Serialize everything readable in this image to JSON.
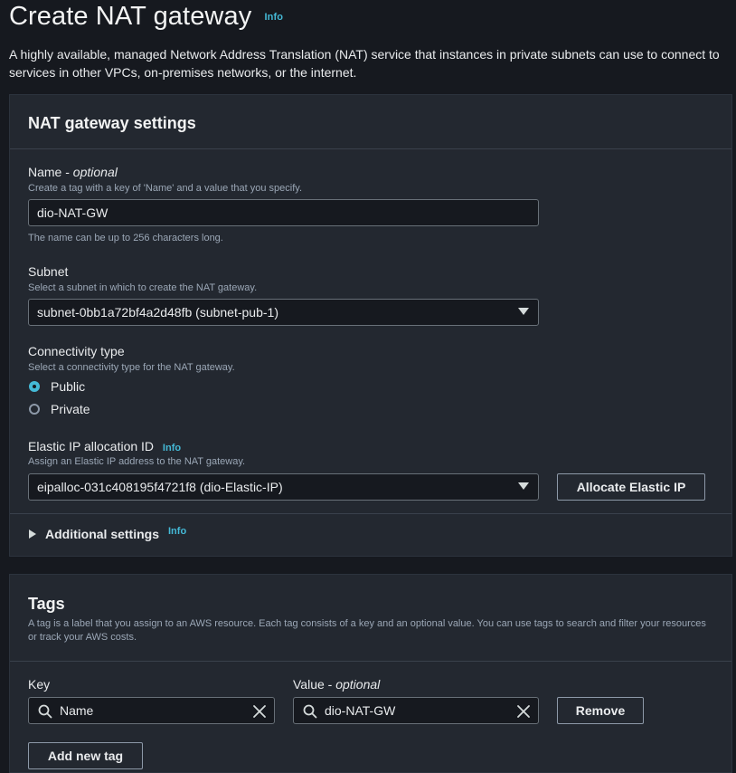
{
  "header": {
    "title": "Create NAT gateway",
    "info": "Info",
    "description": "A highly available, managed Network Address Translation (NAT) service that instances in private subnets can use to connect to services in other VPCs, on-premises networks, or the internet."
  },
  "settings": {
    "title": "NAT gateway settings",
    "name": {
      "label": "Name - ",
      "label_suffix": "optional",
      "description": "Create a tag with a key of 'Name' and a value that you specify.",
      "value": "dio-NAT-GW",
      "constraint": "The name can be up to 256 characters long."
    },
    "subnet": {
      "label": "Subnet",
      "description": "Select a subnet in which to create the NAT gateway.",
      "value": "subnet-0bb1a72bf4a2d48fb (subnet-pub-1)"
    },
    "connectivity": {
      "label": "Connectivity type",
      "description": "Select a connectivity type for the NAT gateway.",
      "options": [
        {
          "label": "Public",
          "selected": true
        },
        {
          "label": "Private",
          "selected": false
        }
      ]
    },
    "elastic_ip": {
      "label": "Elastic IP allocation ID",
      "info": "Info",
      "description": "Assign an Elastic IP address to the NAT gateway.",
      "value": "eipalloc-031c408195f4721f8 (dio-Elastic-IP)",
      "allocate_button": "Allocate Elastic IP"
    },
    "additional": {
      "label": "Additional settings",
      "info": "Info"
    }
  },
  "tags": {
    "title": "Tags",
    "description": "A tag is a label that you assign to an AWS resource. Each tag consists of a key and an optional value. You can use tags to search and filter your resources or track your AWS costs.",
    "key_label": "Key",
    "value_label": "Value - ",
    "value_label_suffix": "optional",
    "rows": [
      {
        "key": "Name",
        "value": "dio-NAT-GW",
        "remove": "Remove"
      }
    ],
    "add_button": "Add new tag"
  },
  "colors": {
    "background": "#16191f",
    "panel": "#232830",
    "accent": "#44b9d6"
  }
}
